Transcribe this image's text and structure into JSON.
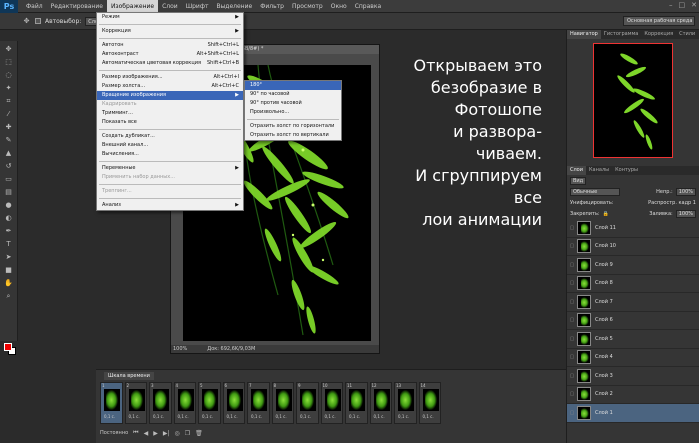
{
  "menubar": {
    "items": [
      "Файл",
      "Редактирование",
      "Изображение",
      "Слои",
      "Шрифт",
      "Выделение",
      "Фильтр",
      "Просмотр",
      "Окно",
      "Справка"
    ],
    "active_index": 2
  },
  "optbar": {
    "autoselect_label": "Автовыбор:",
    "autoselect_value": "Слой",
    "workspace": "Основная рабочая среда"
  },
  "document": {
    "title": "GB/8#) *",
    "zoom": "100%",
    "doc_info": "Док: 692,6K/9,03M"
  },
  "image_menu": {
    "items": [
      {
        "label": "Режим",
        "shortcut": "",
        "submenu": true,
        "disabled": false,
        "hl": false
      },
      {
        "sep": true
      },
      {
        "label": "Коррекция",
        "shortcut": "",
        "submenu": true,
        "disabled": false,
        "hl": false
      },
      {
        "sep": true
      },
      {
        "label": "Автотон",
        "shortcut": "Shift+Ctrl+L",
        "submenu": false,
        "disabled": false,
        "hl": false
      },
      {
        "label": "Автоконтраст",
        "shortcut": "Alt+Shift+Ctrl+L",
        "submenu": false,
        "disabled": false,
        "hl": false
      },
      {
        "label": "Автоматическая цветовая коррекция",
        "shortcut": "Shift+Ctrl+B",
        "submenu": false,
        "disabled": false,
        "hl": false
      },
      {
        "sep": true
      },
      {
        "label": "Размер изображения...",
        "shortcut": "Alt+Ctrl+I",
        "submenu": false,
        "disabled": false,
        "hl": false
      },
      {
        "label": "Размер холста...",
        "shortcut": "Alt+Ctrl+C",
        "submenu": false,
        "disabled": false,
        "hl": false
      },
      {
        "label": "Вращение изображения",
        "shortcut": "",
        "submenu": true,
        "disabled": false,
        "hl": true
      },
      {
        "label": "Кадрировать",
        "shortcut": "",
        "submenu": false,
        "disabled": true,
        "hl": false
      },
      {
        "label": "Тримминг...",
        "shortcut": "",
        "submenu": false,
        "disabled": false,
        "hl": false
      },
      {
        "label": "Показать все",
        "shortcut": "",
        "submenu": false,
        "disabled": false,
        "hl": false
      },
      {
        "sep": true
      },
      {
        "label": "Создать дубликат...",
        "shortcut": "",
        "submenu": false,
        "disabled": false,
        "hl": false
      },
      {
        "label": "Внешний канал...",
        "shortcut": "",
        "submenu": false,
        "disabled": false,
        "hl": false
      },
      {
        "label": "Вычисления...",
        "shortcut": "",
        "submenu": false,
        "disabled": false,
        "hl": false
      },
      {
        "sep": true
      },
      {
        "label": "Переменные",
        "shortcut": "",
        "submenu": true,
        "disabled": false,
        "hl": false
      },
      {
        "label": "Применить набор данных...",
        "shortcut": "",
        "submenu": false,
        "disabled": true,
        "hl": false
      },
      {
        "sep": true
      },
      {
        "label": "Треппинг...",
        "shortcut": "",
        "submenu": false,
        "disabled": true,
        "hl": false
      },
      {
        "sep": true
      },
      {
        "label": "Анализ",
        "shortcut": "",
        "submenu": true,
        "disabled": false,
        "hl": false
      }
    ]
  },
  "rotate_menu": {
    "items": [
      {
        "label": "180°",
        "hl": true
      },
      {
        "label": "90° по часовой",
        "hl": false
      },
      {
        "label": "90° против часовой",
        "hl": false
      },
      {
        "label": "Произвольно...",
        "hl": false
      },
      {
        "sep": true
      },
      {
        "label": "Отразить холст по горизонтали",
        "hl": false
      },
      {
        "label": "Отразить холст по вертикали",
        "hl": false
      }
    ]
  },
  "overlay_text": {
    "lines": [
      "Открываем это",
      "безобразие в",
      "Фотошопе",
      "и развора-",
      "чиваем.",
      "И сгруппируем",
      "все",
      "лои анимации"
    ]
  },
  "navigator": {
    "tabs": [
      "Навигатор",
      "Гистограмма",
      "Коррекция",
      "Стили"
    ]
  },
  "layers": {
    "tabs": [
      "Слои",
      "Каналы",
      "Контуры"
    ],
    "kind_label": "Вид",
    "blend_mode": "Обычные",
    "opacity_label": "Непр.:",
    "opacity": "100%",
    "unify_label": "Унифицировать:",
    "propagate_label": "Распростр. кадр 1",
    "lock_label": "Закрепить:",
    "fill_label": "Заливка:",
    "fill": "100%",
    "items": [
      "Слой 11",
      "Слой 10",
      "Слой 9",
      "Слой 8",
      "Слой 7",
      "Слой 6",
      "Слой 5",
      "Слой 4",
      "Слой 3",
      "Слой 2",
      "Слой 1"
    ],
    "selected_index": 10
  },
  "timeline": {
    "tab": "Шкала времени",
    "frames": [
      {
        "num": "1",
        "delay": "0,1 с."
      },
      {
        "num": "2",
        "delay": "0,1 с."
      },
      {
        "num": "3",
        "delay": "0,1 с."
      },
      {
        "num": "4",
        "delay": "0,1 с."
      },
      {
        "num": "5",
        "delay": "0,1 с."
      },
      {
        "num": "6",
        "delay": "0,1 с."
      },
      {
        "num": "7",
        "delay": "0,1 с."
      },
      {
        "num": "8",
        "delay": "0,1 с."
      },
      {
        "num": "9",
        "delay": "0,1 с."
      },
      {
        "num": "10",
        "delay": "0,1 с."
      },
      {
        "num": "11",
        "delay": "0,1 с."
      },
      {
        "num": "12",
        "delay": "0,1 с."
      },
      {
        "num": "13",
        "delay": "0,1 с."
      },
      {
        "num": "14",
        "delay": "0,1 с."
      }
    ],
    "loop": "Постоянно",
    "selected_index": 0
  }
}
